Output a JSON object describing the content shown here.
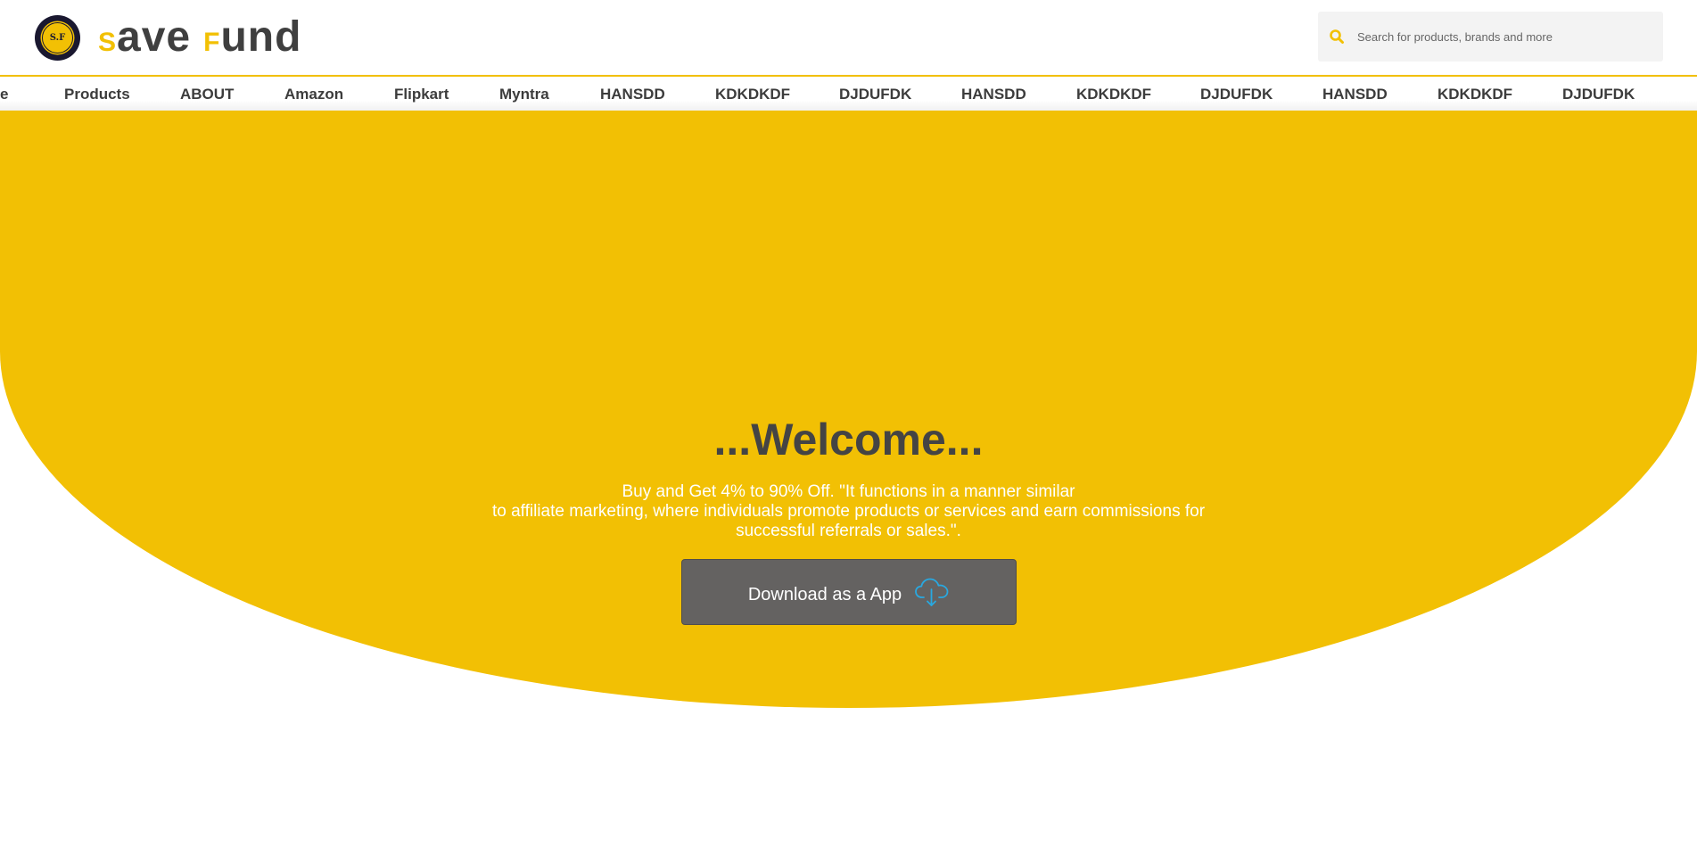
{
  "header": {
    "logo_text": "S.F",
    "brand": {
      "part1_accent": "S",
      "part1_rest": "ave",
      "part2_accent": "F",
      "part2_rest": "und"
    },
    "search": {
      "placeholder": "Search for products, brands and more",
      "icon": "search-icon"
    }
  },
  "nav": {
    "items": [
      "e",
      "Products",
      "ABOUT",
      "Amazon",
      "Flipkart",
      "Myntra",
      "HANSDD",
      "KDKDKDF",
      "DJDUFDK",
      "HANSDD",
      "KDKDKDF",
      "DJDUFDK",
      "HANSDD",
      "KDKDKDF",
      "DJDUFDK"
    ]
  },
  "hero": {
    "title": "...Welcome...",
    "text_line1": "Buy and Get 4% to 90% Off. \"It functions in a manner similar",
    "text_line2": "to affiliate marketing, where individuals promote products or services and earn commissions for",
    "text_line3": "successful referrals or sales.\".",
    "button_label": "Download as a App",
    "button_icon": "cloud-download-icon"
  },
  "colors": {
    "accent": "#f2c004",
    "text_dark": "#444444",
    "button_bg": "#646261",
    "icon_blue": "#29a8e0"
  }
}
